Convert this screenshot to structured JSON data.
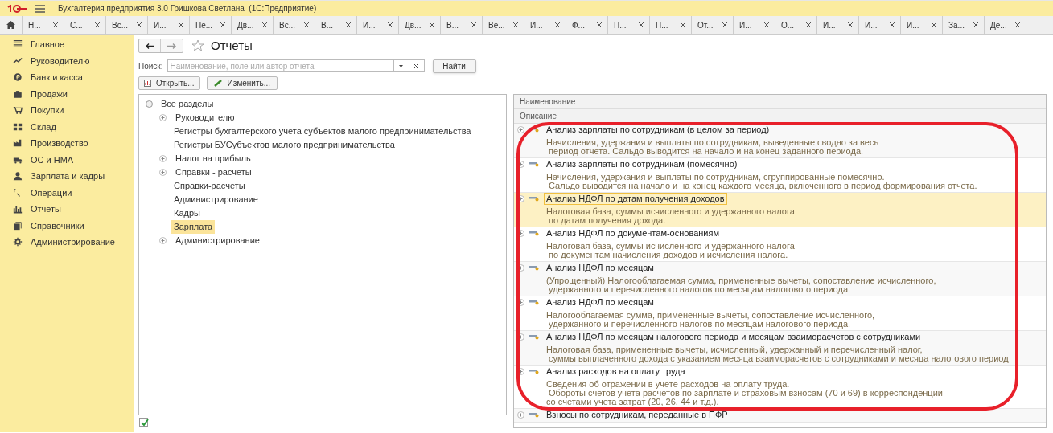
{
  "window": {
    "title": "Бухгалтерия предприятия 3.0 Гришкова Светлана  (1С:Предприятие)"
  },
  "open_tabs": [
    {
      "label": "Н..."
    },
    {
      "label": "С..."
    },
    {
      "label": "Вс..."
    },
    {
      "label": "И..."
    },
    {
      "label": "Пе..."
    },
    {
      "label": "Дв..."
    },
    {
      "label": "Вс..."
    },
    {
      "label": "В..."
    },
    {
      "label": "И..."
    },
    {
      "label": "Дв..."
    },
    {
      "label": "В..."
    },
    {
      "label": "Ве..."
    },
    {
      "label": "И..."
    },
    {
      "label": "Ф..."
    },
    {
      "label": "П..."
    },
    {
      "label": "П..."
    },
    {
      "label": "От..."
    },
    {
      "label": "И..."
    },
    {
      "label": "О..."
    },
    {
      "label": "И..."
    },
    {
      "label": "И..."
    },
    {
      "label": "И..."
    },
    {
      "label": "За..."
    },
    {
      "label": "Де..."
    }
  ],
  "sidebar": {
    "items": [
      {
        "label": "Главное"
      },
      {
        "label": "Руководителю"
      },
      {
        "label": "Банк и касса"
      },
      {
        "label": "Продажи"
      },
      {
        "label": "Покупки"
      },
      {
        "label": "Склад"
      },
      {
        "label": "Производство"
      },
      {
        "label": "ОС и НМА"
      },
      {
        "label": "Зарплата и кадры"
      },
      {
        "label": "Операции"
      },
      {
        "label": "Отчеты"
      },
      {
        "label": "Справочники"
      },
      {
        "label": "Администрирование"
      }
    ]
  },
  "page": {
    "title": "Отчеты",
    "search_label": "Поиск:",
    "search": {
      "placeholder": "Наименование, поле или автор отчета"
    },
    "find_button": "Найти",
    "open_button": "Открыть...",
    "edit_button": "Изменить..."
  },
  "tree": {
    "label": "Все разделы",
    "expanded": true,
    "children": [
      {
        "label": "Руководителю",
        "expandable": true,
        "selected": false
      },
      {
        "label": "Регистры бухгалтерского учета субъектов малого предпринимательства",
        "expandable": false,
        "selected": false
      },
      {
        "label": "Регистры БУСубъектов малого предпринимательства",
        "expandable": false,
        "selected": false
      },
      {
        "label": "Налог на прибыль",
        "expandable": true,
        "selected": false
      },
      {
        "label": "Справки - расчеты",
        "expandable": true,
        "selected": false
      },
      {
        "label": "Справки-расчеты",
        "expandable": false,
        "selected": false
      },
      {
        "label": "Администрирование",
        "expandable": false,
        "selected": false
      },
      {
        "label": "Кадры",
        "expandable": false,
        "selected": false
      },
      {
        "label": "Зарплата",
        "expandable": false,
        "selected": true
      },
      {
        "label": "Администрирование",
        "expandable": true,
        "selected": false
      }
    ]
  },
  "reports": {
    "columns": [
      "Наименование",
      "Описание"
    ],
    "rows": [
      {
        "name": "Анализ зарплаты по сотрудникам (в целом за период)",
        "description": [
          "Начисления, удержания и выплаты по сотрудникам, выведенные сводно за весь",
          " период отчета. Сальдо выводится на начало и на конец заданного периода."
        ],
        "selected": false
      },
      {
        "name": "Анализ зарплаты по сотрудникам (помесячно)",
        "description": [
          "Начисления, удержания и выплаты по сотрудникам, сгруппированные помесячно.",
          " Сальдо выводится на начало и на конец каждого месяца, включенного в период формирования отчета."
        ],
        "selected": false
      },
      {
        "name": "Анализ НДФЛ по датам получения доходов",
        "description": [
          "Налоговая база, суммы исчисленного и удержанного налога",
          " по датам получения дохода."
        ],
        "selected": true
      },
      {
        "name": "Анализ НДФЛ по документам-основаниям",
        "description": [
          "Налоговая база, суммы исчисленного и удержанного налога",
          " по документам начисления доходов и исчисления налога."
        ],
        "selected": false
      },
      {
        "name": "Анализ НДФЛ по месяцам",
        "description": [
          "(Упрощенный) Налогооблагаемая сумма, примененные вычеты, сопоставление исчисленного,",
          " удержанного и перечисленного налогов по месяцам налогового периода."
        ],
        "selected": false
      },
      {
        "name": "Анализ НДФЛ по месяцам",
        "description": [
          "Налогооблагаемая сумма, примененные вычеты, сопоставление исчисленного,",
          " удержанного и перечисленного налогов по месяцам налогового периода."
        ],
        "selected": false
      },
      {
        "name": "Анализ НДФЛ по месяцам налогового периода и месяцам взаиморасчетов с сотрудниками",
        "description": [
          "Налоговая база, примененные вычеты, исчисленный, удержанный и перечисленный налог,",
          " суммы выплаченного дохода с указанием месяца взаиморасчетов с сотрудниками и месяца налогового период"
        ],
        "selected": false
      },
      {
        "name": "Анализ расходов на оплату труда",
        "description": [
          "Сведения об отражении в учете расходов на оплату труда.",
          " Обороты счетов учета расчетов по зарплате и страховым взносам (70 и 69) в корреспонденции",
          "со счетами учета затрат (20, 26, 44 и т.д.)."
        ],
        "selected": false
      },
      {
        "name": "Взносы по сотрудникам, переданные в ПФР",
        "description": [],
        "selected": false
      }
    ]
  },
  "footer": {
    "checkbox": {
      "checked": true
    }
  }
}
